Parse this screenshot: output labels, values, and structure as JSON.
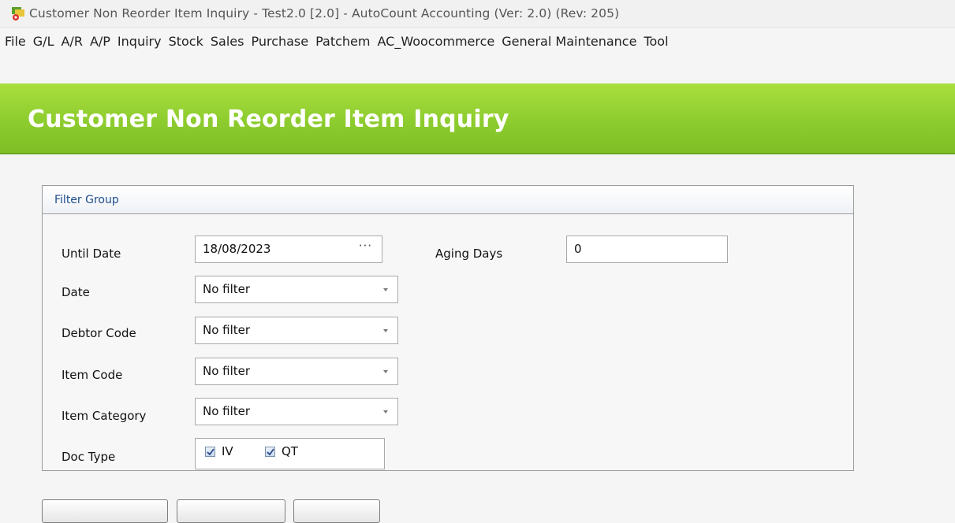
{
  "window": {
    "title": "Customer Non Reorder Item Inquiry - Test2.0 [2.0] - AutoCount Accounting (Ver: 2.0) (Rev: 205)",
    "app_icon": "autocount-app-icon"
  },
  "menu": {
    "items": [
      "File",
      "G/L",
      "A/R",
      "A/P",
      "Inquiry",
      "Stock",
      "Sales",
      "Purchase",
      "Patchem",
      "AC_Woocommerce",
      "General Maintenance",
      "Tool"
    ]
  },
  "banner": {
    "title": "Customer Non Reorder Item Inquiry"
  },
  "filter_group": {
    "title": "Filter Group",
    "until_date": {
      "label": "Until Date",
      "value": "18/08/2023",
      "button": "···"
    },
    "aging_days": {
      "label": "Aging Days",
      "value": "0"
    },
    "date": {
      "label": "Date",
      "value": "No filter"
    },
    "debtor_code": {
      "label": "Debtor Code",
      "value": "No filter"
    },
    "item_code": {
      "label": "Item Code",
      "value": "No filter"
    },
    "item_category": {
      "label": "Item Category",
      "value": "No filter"
    },
    "doc_type": {
      "label": "Doc Type",
      "options": [
        {
          "label": "IV",
          "checked": true
        },
        {
          "label": "QT",
          "checked": true
        }
      ]
    }
  },
  "colors": {
    "banner_green": "#8dcc2e",
    "group_title_blue": "#1f4e8a"
  }
}
